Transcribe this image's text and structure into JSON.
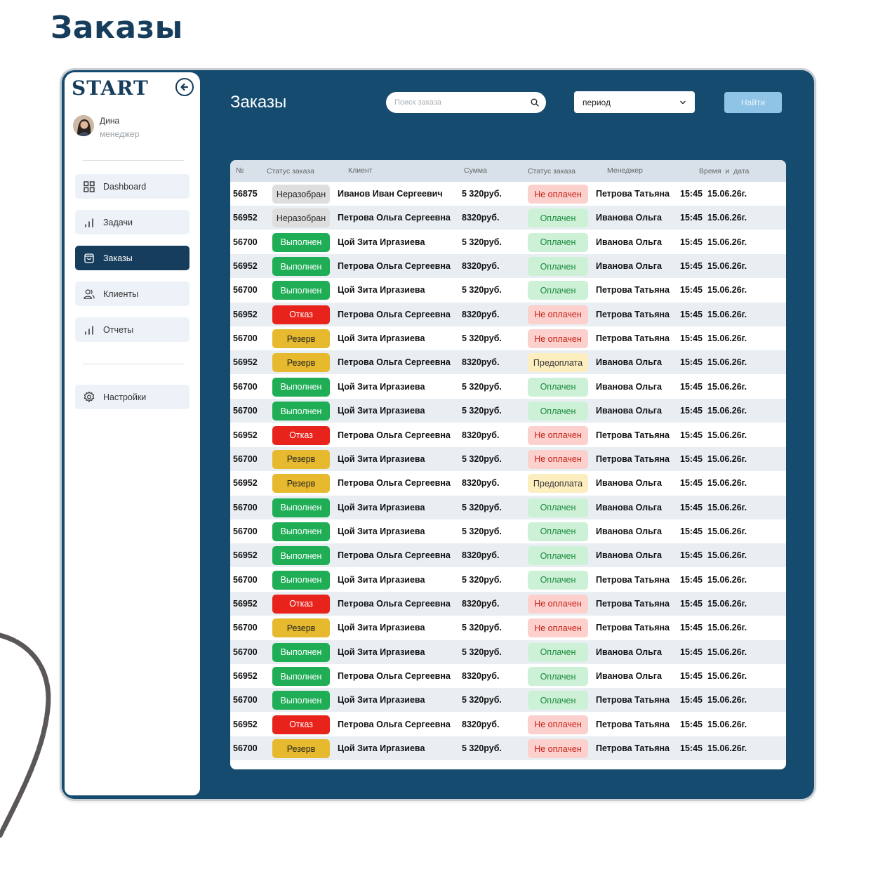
{
  "heading": "Заказы",
  "sidebar": {
    "logo": "START",
    "user": {
      "name": "Дина",
      "role": "менеджер"
    },
    "items": [
      {
        "label": "Dashboard",
        "icon": "grid-icon",
        "active": false
      },
      {
        "label": "Задачи",
        "icon": "bar-chart-icon",
        "active": false
      },
      {
        "label": "Заказы",
        "icon": "bag-icon",
        "active": true
      },
      {
        "label": "Клиенты",
        "icon": "users-icon",
        "active": false
      },
      {
        "label": "Отчеты",
        "icon": "bar-chart-icon",
        "active": false
      }
    ],
    "settings": {
      "label": "Настройки",
      "icon": "gear-icon"
    }
  },
  "main": {
    "title": "Заказы",
    "search_placeholder": "Поиск заказа",
    "period_value": "период",
    "find_label": "Найти"
  },
  "table": {
    "headers": [
      "№",
      "Статус заказа",
      "Клиент",
      "Сумма",
      "Статус заказа",
      "Менеджер",
      "Время  и  дата"
    ],
    "status_colors": {
      "Неразобран": {
        "bg": "#dedede",
        "fg": "#222222"
      },
      "Выполнен": {
        "bg": "#1fae55",
        "fg": "#ffffff"
      },
      "Отказ": {
        "bg": "#e8231c",
        "fg": "#ffffff"
      },
      "Резерв": {
        "bg": "#e6b92e",
        "fg": "#222222"
      }
    },
    "payment_colors": {
      "Не оплачен": {
        "bg": "#fbd0cd",
        "fg": "#c81e14"
      },
      "Оплачен": {
        "bg": "#cdf1d6",
        "fg": "#1a8a3c"
      },
      "Предоплата": {
        "bg": "#fdeec0",
        "fg": "#333333"
      }
    },
    "rows": [
      {
        "id": "56875",
        "status": "Неразобран",
        "client": "Иванов Иван Сергеевич",
        "sum": "5 320руб.",
        "payment": "Не оплачен",
        "manager": "Петрова Татьяна",
        "time": "15:45",
        "date": "15.06.26г."
      },
      {
        "id": "56952",
        "status": "Неразобран",
        "client": "Петрова Ольга Сергеевна",
        "sum": "8320руб.",
        "payment": "Оплачен",
        "manager": "Иванова Ольга",
        "time": "15:45",
        "date": "15.06.26г."
      },
      {
        "id": "56700",
        "status": "Выполнен",
        "client": "Цой Зита Иргазиева",
        "sum": "5 320руб.",
        "payment": "Оплачен",
        "manager": "Иванова Ольга",
        "time": "15:45",
        "date": "15.06.26г."
      },
      {
        "id": "56952",
        "status": "Выполнен",
        "client": "Петрова Ольга Сергеевна",
        "sum": "8320руб.",
        "payment": "Оплачен",
        "manager": "Иванова Ольга",
        "time": "15:45",
        "date": "15.06.26г."
      },
      {
        "id": "56700",
        "status": "Выполнен",
        "client": "Цой Зита Иргазиева",
        "sum": "5 320руб.",
        "payment": "Оплачен",
        "manager": "Петрова Татьяна",
        "time": "15:45",
        "date": "15.06.26г."
      },
      {
        "id": "56952",
        "status": "Отказ",
        "client": "Петрова Ольга Сергеевна",
        "sum": "8320руб.",
        "payment": "Не оплачен",
        "manager": "Петрова Татьяна",
        "time": "15:45",
        "date": "15.06.26г."
      },
      {
        "id": "56700",
        "status": "Резерв",
        "client": "Цой Зита Иргазиева",
        "sum": "5 320руб.",
        "payment": "Не оплачен",
        "manager": "Петрова Татьяна",
        "time": "15:45",
        "date": "15.06.26г."
      },
      {
        "id": "56952",
        "status": "Резерв",
        "client": "Петрова Ольга Сергеевна",
        "sum": "8320руб.",
        "payment": "Предоплата",
        "manager": "Иванова Ольга",
        "time": "15:45",
        "date": "15.06.26г."
      },
      {
        "id": "56700",
        "status": "Выполнен",
        "client": "Цой Зита Иргазиева",
        "sum": "5 320руб.",
        "payment": "Оплачен",
        "manager": "Иванова Ольга",
        "time": "15:45",
        "date": "15.06.26г."
      },
      {
        "id": "56700",
        "status": "Выполнен",
        "client": "Цой Зита Иргазиева",
        "sum": "5 320руб.",
        "payment": "Оплачен",
        "manager": "Иванова Ольга",
        "time": "15:45",
        "date": "15.06.26г."
      },
      {
        "id": "56952",
        "status": "Отказ",
        "client": "Петрова Ольга Сергеевна",
        "sum": "8320руб.",
        "payment": "Не оплачен",
        "manager": "Петрова Татьяна",
        "time": "15:45",
        "date": "15.06.26г."
      },
      {
        "id": "56700",
        "status": "Резерв",
        "client": "Цой Зита Иргазиева",
        "sum": "5 320руб.",
        "payment": "Не оплачен",
        "manager": "Петрова Татьяна",
        "time": "15:45",
        "date": "15.06.26г."
      },
      {
        "id": "56952",
        "status": "Резерв",
        "client": "Петрова Ольга Сергеевна",
        "sum": "8320руб.",
        "payment": "Предоплата",
        "manager": "Иванова Ольга",
        "time": "15:45",
        "date": "15.06.26г."
      },
      {
        "id": "56700",
        "status": "Выполнен",
        "client": "Цой Зита Иргазиева",
        "sum": "5 320руб.",
        "payment": "Оплачен",
        "manager": "Иванова Ольга",
        "time": "15:45",
        "date": "15.06.26г."
      },
      {
        "id": "56700",
        "status": "Выполнен",
        "client": "Цой Зита Иргазиева",
        "sum": "5 320руб.",
        "payment": "Оплачен",
        "manager": "Иванова Ольга",
        "time": "15:45",
        "date": "15.06.26г."
      },
      {
        "id": "56952",
        "status": "Выполнен",
        "client": "Петрова Ольга Сергеевна",
        "sum": "8320руб.",
        "payment": "Оплачен",
        "manager": "Иванова Ольга",
        "time": "15:45",
        "date": "15.06.26г."
      },
      {
        "id": "56700",
        "status": "Выполнен",
        "client": "Цой Зита Иргазиева",
        "sum": "5 320руб.",
        "payment": "Оплачен",
        "manager": "Петрова Татьяна",
        "time": "15:45",
        "date": "15.06.26г."
      },
      {
        "id": "56952",
        "status": "Отказ",
        "client": "Петрова Ольга Сергеевна",
        "sum": "8320руб.",
        "payment": "Не оплачен",
        "manager": "Петрова Татьяна",
        "time": "15:45",
        "date": "15.06.26г."
      },
      {
        "id": "56700",
        "status": "Резерв",
        "client": "Цой Зита Иргазиева",
        "sum": "5 320руб.",
        "payment": "Не оплачен",
        "manager": "Петрова Татьяна",
        "time": "15:45",
        "date": "15.06.26г."
      },
      {
        "id": "56700",
        "status": "Выполнен",
        "client": "Цой Зита Иргазиева",
        "sum": "5 320руб.",
        "payment": "Оплачен",
        "manager": "Иванова Ольга",
        "time": "15:45",
        "date": "15.06.26г."
      },
      {
        "id": "56952",
        "status": "Выполнен",
        "client": "Петрова Ольга Сергеевна",
        "sum": "8320руб.",
        "payment": "Оплачен",
        "manager": "Иванова Ольга",
        "time": "15:45",
        "date": "15.06.26г."
      },
      {
        "id": "56700",
        "status": "Выполнен",
        "client": "Цой Зита Иргазиева",
        "sum": "5 320руб.",
        "payment": "Оплачен",
        "manager": "Петрова Татьяна",
        "time": "15:45",
        "date": "15.06.26г."
      },
      {
        "id": "56952",
        "status": "Отказ",
        "client": "Петрова Ольга Сергеевна",
        "sum": "8320руб.",
        "payment": "Не оплачен",
        "manager": "Петрова Татьяна",
        "time": "15:45",
        "date": "15.06.26г."
      },
      {
        "id": "56700",
        "status": "Резерв",
        "client": "Цой Зита Иргазиева",
        "sum": "5 320руб.",
        "payment": "Не оплачен",
        "manager": "Петрова Татьяна",
        "time": "15:45",
        "date": "15.06.26г."
      }
    ]
  }
}
